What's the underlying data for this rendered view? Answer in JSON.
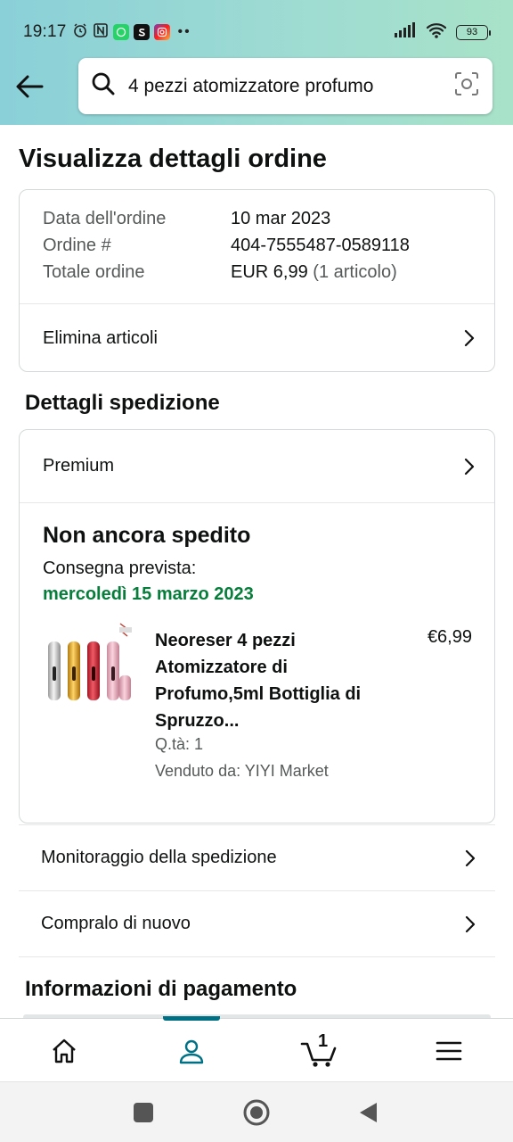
{
  "status_bar": {
    "time": "19:17",
    "battery": "93"
  },
  "search": {
    "query": "4 pezzi atomizzatore profumo"
  },
  "page_title": "Visualizza dettagli ordine",
  "order": {
    "date_label": "Data dell'ordine",
    "date_value": "10 mar 2023",
    "number_label": "Ordine #",
    "number_value": "404-7555487-0589118",
    "total_label": "Totale ordine",
    "total_value": "EUR 6,99",
    "total_items": "(1 articolo)",
    "delete_items": "Elimina articoli"
  },
  "shipping": {
    "section_title": "Dettagli spedizione",
    "service": "Premium",
    "status": "Non ancora spedito",
    "delivery_label": "Consegna prevista:",
    "delivery_date": "mercoledì 15 marzo 2023",
    "item": {
      "title": "Neoreser 4 pezzi Atomizzatore di Profumo,5ml Bottiglia di Spruzzo...",
      "price": "€6,99",
      "qty": "Q.tà: 1",
      "seller": "Venduto da: YIYI Market"
    }
  },
  "actions": {
    "track": "Monitoraggio della spedizione",
    "buy_again": "Compralo di nuovo"
  },
  "payment": {
    "section_title": "Informazioni di pagamento"
  },
  "bottom_nav": {
    "items": [
      "home-icon",
      "account-icon",
      "cart-icon",
      "menu-icon"
    ],
    "cart_count": "1",
    "active_color": "#007185"
  },
  "colors": {
    "accent": "#007185",
    "delivery_green": "#067d3a"
  }
}
